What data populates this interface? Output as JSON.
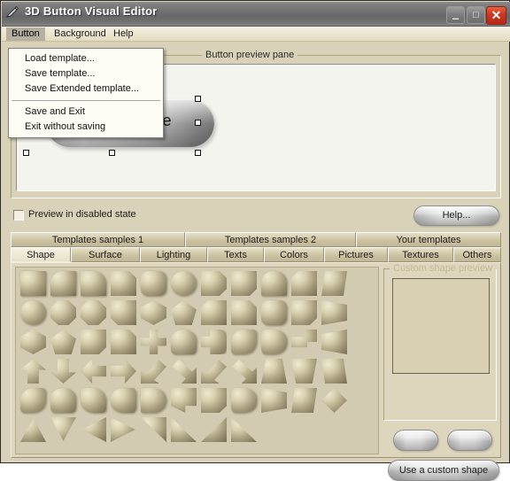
{
  "window": {
    "title": "3D Button Visual Editor",
    "icon": "pen-cursor-icon",
    "buttons": {
      "minimize": "–",
      "maximize": "□",
      "close": "✕"
    }
  },
  "colors": {
    "window_bg": "#d9d2b8",
    "titlebar": "#6f6f6f",
    "close_red": "#cc3621",
    "panel_bg": "#ded6bc",
    "grid_bg": "#d3cbb1",
    "preview_bg": "#f4f4ef",
    "accent_text": "#1a1a1a"
  },
  "menubar": {
    "items": [
      {
        "label": "Button",
        "active": true
      },
      {
        "label": "Background",
        "active": false
      },
      {
        "label": "Help",
        "active": false
      }
    ]
  },
  "dropdown": {
    "open_for": "Button",
    "groups": [
      {
        "items": [
          "Load template...",
          "Save template...",
          "Save Extended template..."
        ]
      },
      {
        "items": [
          "Save and Exit",
          "Exit without saving"
        ]
      }
    ]
  },
  "preview_pane": {
    "title": "Button preview pane",
    "button": {
      "label": "Home page",
      "selected": true,
      "handle_count": 8
    }
  },
  "options": {
    "preview_disabled": {
      "label": "Preview in disabled state",
      "checked": false
    },
    "help_button": "Help..."
  },
  "tabs": {
    "top_row": [
      {
        "label": "Templates samples 1",
        "selected": false
      },
      {
        "label": "Templates samples 2",
        "selected": false
      },
      {
        "label": "Your templates",
        "selected": false
      }
    ],
    "bottom_row": [
      {
        "label": "Shape",
        "selected": true
      },
      {
        "label": "Surface",
        "selected": false
      },
      {
        "label": "Lighting",
        "selected": false
      },
      {
        "label": "Texts",
        "selected": false
      },
      {
        "label": "Colors",
        "selected": false
      },
      {
        "label": "Pictures",
        "selected": false
      },
      {
        "label": "Textures",
        "selected": false
      },
      {
        "label": "Others",
        "selected": false
      }
    ]
  },
  "shape_grid": {
    "columns": 12,
    "rows": 6,
    "shapes": [
      "s-square",
      "s-r1",
      "s-r2",
      "s-cut1",
      "s-rr",
      "s-round",
      "s-cutd",
      "s-cut3",
      "s-rrb",
      "s-cut4",
      "s-lean",
      "",
      "s-round",
      "s-oct",
      "s-oct",
      "s-cut2",
      "s-hex2",
      "s-pent",
      "s-cut4",
      "s-cut1",
      "s-rr",
      "s-cut3",
      "s-wedge",
      "",
      "s-hex2",
      "s-pent",
      "s-cut3",
      "s-cut1",
      "s-clover",
      "s-blob1",
      "s-dumb",
      "s-blob4",
      "s-blob2",
      "s-key",
      "s-wedge2",
      "",
      "s-arr-u",
      "s-arr-d",
      "s-arr-l",
      "s-arr-r",
      "s-arr-dl",
      "s-arr-dr",
      "s-arr-dl",
      "s-arr-dr",
      "s-trap",
      "s-trap2",
      "s-lean2",
      "",
      "s-blob4",
      "s-blob1",
      "s-blob5",
      "s-blob3",
      "s-bullet",
      "s-flag",
      "s-cut3",
      "s-blob2",
      "s-wedge",
      "s-lean",
      "s-diam",
      "",
      "s-tri-u",
      "s-tri-d",
      "s-tri-l",
      "s-tri-r",
      "s-tri-tr",
      "s-tri-bl",
      "s-tri-br",
      "s-tri-bl",
      "",
      "",
      "",
      ""
    ]
  },
  "custom_panel": {
    "title": "Custom shape preview",
    "nav_buttons": [
      "",
      ""
    ],
    "use_button": "Use a custom shape"
  }
}
